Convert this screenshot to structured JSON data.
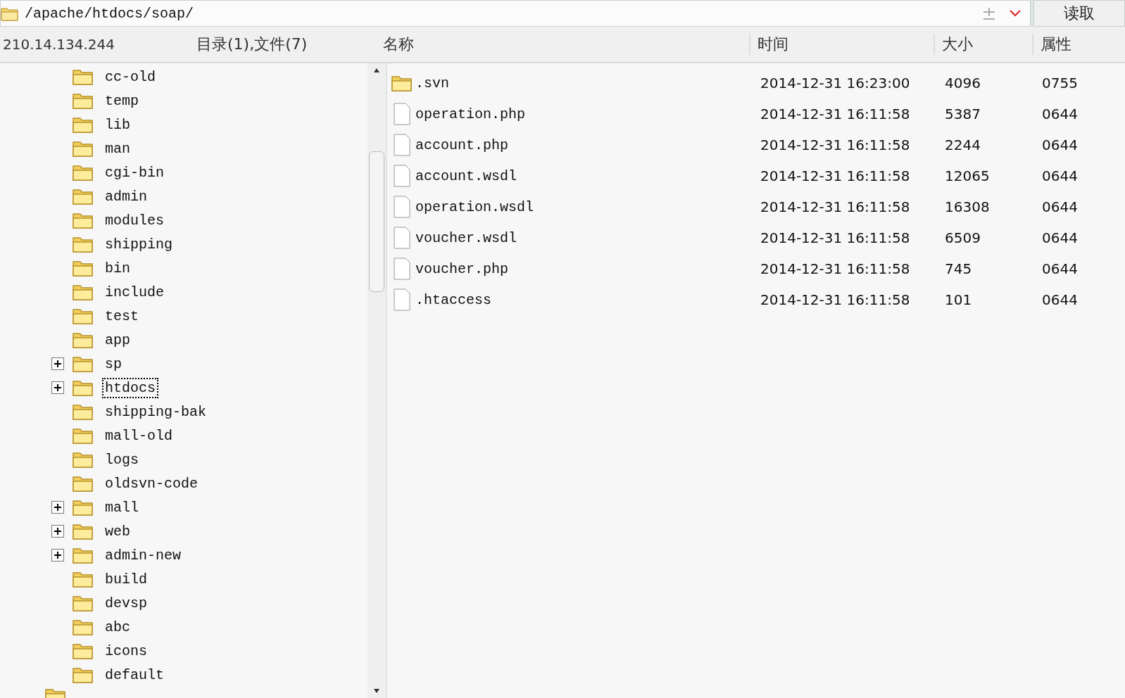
{
  "path_bar": {
    "path": "/apache/htdocs/soap/",
    "read_button": "读取"
  },
  "left_header": {
    "host": "210.14.134.244",
    "summary": "目录(1),文件(7)"
  },
  "columns": [
    "名称",
    "时间",
    "大小",
    "属性"
  ],
  "tree": [
    {
      "name": "cc-old",
      "expandable": false,
      "selected": false
    },
    {
      "name": "temp",
      "expandable": false,
      "selected": false
    },
    {
      "name": "lib",
      "expandable": false,
      "selected": false
    },
    {
      "name": "man",
      "expandable": false,
      "selected": false
    },
    {
      "name": "cgi-bin",
      "expandable": false,
      "selected": false
    },
    {
      "name": "admin",
      "expandable": false,
      "selected": false
    },
    {
      "name": "modules",
      "expandable": false,
      "selected": false
    },
    {
      "name": "shipping",
      "expandable": false,
      "selected": false
    },
    {
      "name": "bin",
      "expandable": false,
      "selected": false
    },
    {
      "name": "include",
      "expandable": false,
      "selected": false
    },
    {
      "name": "test",
      "expandable": false,
      "selected": false
    },
    {
      "name": "app",
      "expandable": false,
      "selected": false
    },
    {
      "name": "sp",
      "expandable": true,
      "selected": false
    },
    {
      "name": "htdocs",
      "expandable": true,
      "selected": true
    },
    {
      "name": "shipping-bak",
      "expandable": false,
      "selected": false
    },
    {
      "name": "mall-old",
      "expandable": false,
      "selected": false
    },
    {
      "name": "logs",
      "expandable": false,
      "selected": false
    },
    {
      "name": "oldsvn-code",
      "expandable": false,
      "selected": false
    },
    {
      "name": "mall",
      "expandable": true,
      "selected": false
    },
    {
      "name": "web",
      "expandable": true,
      "selected": false
    },
    {
      "name": "admin-new",
      "expandable": true,
      "selected": false
    },
    {
      "name": "build",
      "expandable": false,
      "selected": false
    },
    {
      "name": "devsp",
      "expandable": false,
      "selected": false
    },
    {
      "name": "abc",
      "expandable": false,
      "selected": false
    },
    {
      "name": "icons",
      "expandable": false,
      "selected": false
    },
    {
      "name": "default",
      "expandable": false,
      "selected": false
    }
  ],
  "files": [
    {
      "kind": "folder",
      "name": ".svn",
      "time": "2014-12-31 16:23:00",
      "size": "4096",
      "attr": "0755"
    },
    {
      "kind": "file",
      "name": "operation.php",
      "time": "2014-12-31 16:11:58",
      "size": "5387",
      "attr": "0644"
    },
    {
      "kind": "file",
      "name": "account.php",
      "time": "2014-12-31 16:11:58",
      "size": "2244",
      "attr": "0644"
    },
    {
      "kind": "file",
      "name": "account.wsdl",
      "time": "2014-12-31 16:11:58",
      "size": "12065",
      "attr": "0644"
    },
    {
      "kind": "file",
      "name": "operation.wsdl",
      "time": "2014-12-31 16:11:58",
      "size": "16308",
      "attr": "0644"
    },
    {
      "kind": "file",
      "name": "voucher.wsdl",
      "time": "2014-12-31 16:11:58",
      "size": "6509",
      "attr": "0644"
    },
    {
      "kind": "file",
      "name": "voucher.php",
      "time": "2014-12-31 16:11:58",
      "size": "745",
      "attr": "0644"
    },
    {
      "kind": "file",
      "name": ".htaccess",
      "time": "2014-12-31 16:11:58",
      "size": "101",
      "attr": "0644"
    }
  ]
}
